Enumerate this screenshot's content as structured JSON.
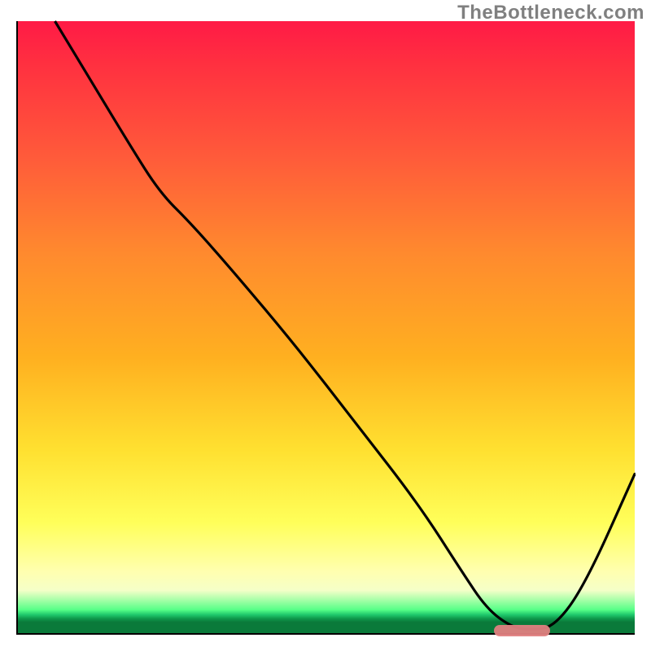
{
  "watermark": "TheBottleneck.com",
  "colors": {
    "top": "#ff1a46",
    "mid1": "#ff8a2e",
    "mid2": "#ffe030",
    "pale": "#ffffb0",
    "greenLight": "#56ff87",
    "greenDark": "#0a7a3a",
    "curve": "#000000",
    "marker": "#e08080"
  },
  "chart_data": {
    "type": "line",
    "title": "",
    "xlabel": "",
    "ylabel": "",
    "xlim": [
      0,
      100
    ],
    "ylim": [
      0,
      100
    ],
    "grid": false,
    "legend": false,
    "annotations": [
      {
        "text": "TheBottleneck.com",
        "position": "top-right"
      }
    ],
    "series": [
      {
        "name": "curve",
        "x": [
          6,
          12,
          18,
          23,
          28,
          35,
          45,
          55,
          65,
          72,
          76,
          80,
          83,
          87,
          92,
          100
        ],
        "y": [
          100,
          90,
          80,
          72,
          67,
          59,
          47,
          34,
          21,
          10,
          4,
          1,
          0.5,
          1,
          8,
          26
        ]
      }
    ],
    "marker": {
      "comment": "short horizontal highlight on x-axis (optimal zone)",
      "x_start": 77,
      "x_end": 86,
      "y": 0.6
    }
  }
}
